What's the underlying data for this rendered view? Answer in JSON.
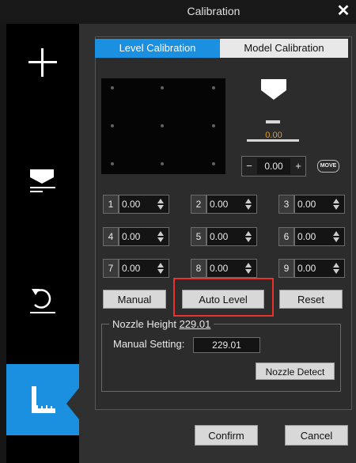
{
  "window": {
    "title": "Calibration",
    "close_glyph": "✕"
  },
  "sidebar": {
    "items": [
      {
        "icon": "plus-icon"
      },
      {
        "icon": "level-icon"
      },
      {
        "icon": "rotate-icon"
      },
      {
        "icon": "ruler-icon",
        "active": true
      }
    ],
    "active_color": "#1b8fe0"
  },
  "tabs": [
    {
      "label": "Level Calibration",
      "active": true
    },
    {
      "label": "Model Calibration",
      "active": false
    }
  ],
  "stepper": {
    "minus": "−",
    "value": "0.00",
    "plus": "+"
  },
  "move_label": "MOVE",
  "bed_value": "0.00",
  "points": [
    {
      "num": "1",
      "value": "0.00"
    },
    {
      "num": "2",
      "value": "0.00"
    },
    {
      "num": "3",
      "value": "0.00"
    },
    {
      "num": "4",
      "value": "0.00"
    },
    {
      "num": "5",
      "value": "0.00"
    },
    {
      "num": "6",
      "value": "0.00"
    },
    {
      "num": "7",
      "value": "0.00"
    },
    {
      "num": "8",
      "value": "0.00"
    },
    {
      "num": "9",
      "value": "0.00"
    }
  ],
  "actions": {
    "manual": "Manual",
    "auto_level": "Auto Level",
    "reset": "Reset"
  },
  "nozzle": {
    "label": "Nozzle Height",
    "height_value": "229.01",
    "manual_label": "Manual Setting:",
    "manual_value": "229.01",
    "detect": "Nozzle Detect"
  },
  "footer": {
    "confirm": "Confirm",
    "cancel": "Cancel"
  },
  "colors": {
    "accent": "#1b8fe0",
    "highlight": "#e8322a",
    "bed_value": "#e09a22"
  }
}
